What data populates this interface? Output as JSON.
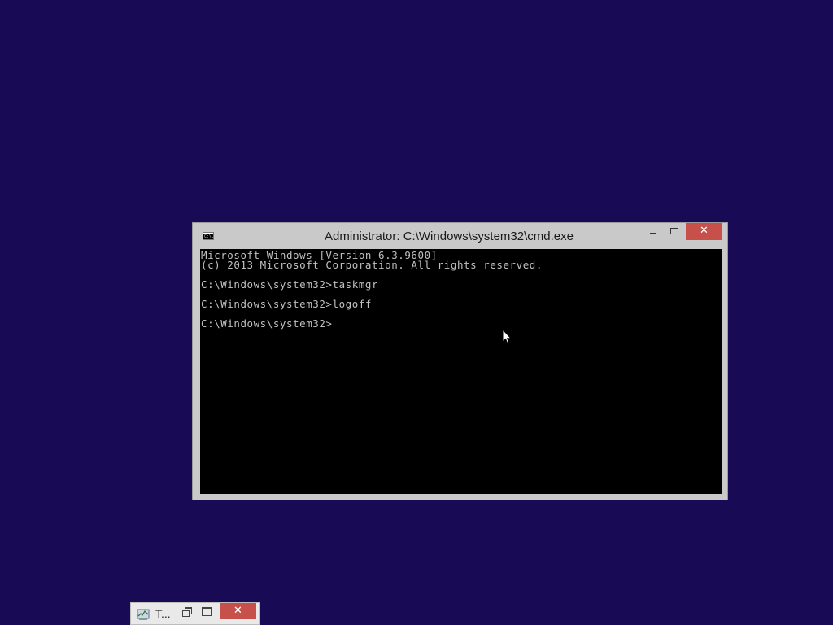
{
  "desktop": {
    "background_color": "#190a55"
  },
  "cmd_window": {
    "title": "Administrator: C:\\Windows\\system32\\cmd.exe",
    "app_icon_text": "C:\\.",
    "close_glyph": "✕",
    "console_lines": [
      "Microsoft Windows [Version 6.3.9600]",
      "(c) 2013 Microsoft Corporation. All rights reserved.",
      "",
      "C:\\Windows\\system32>taskmgr",
      "",
      "C:\\Windows\\system32>logoff",
      "",
      "C:\\Windows\\system32>"
    ],
    "colors": {
      "frame": "#c9c9c9",
      "console_bg": "#000000",
      "console_text": "#c0c0c0",
      "close_button": "#c7504a"
    }
  },
  "minimized_taskmgr": {
    "title": "T...",
    "icon": "task-manager-icon",
    "close_glyph": "✕"
  }
}
